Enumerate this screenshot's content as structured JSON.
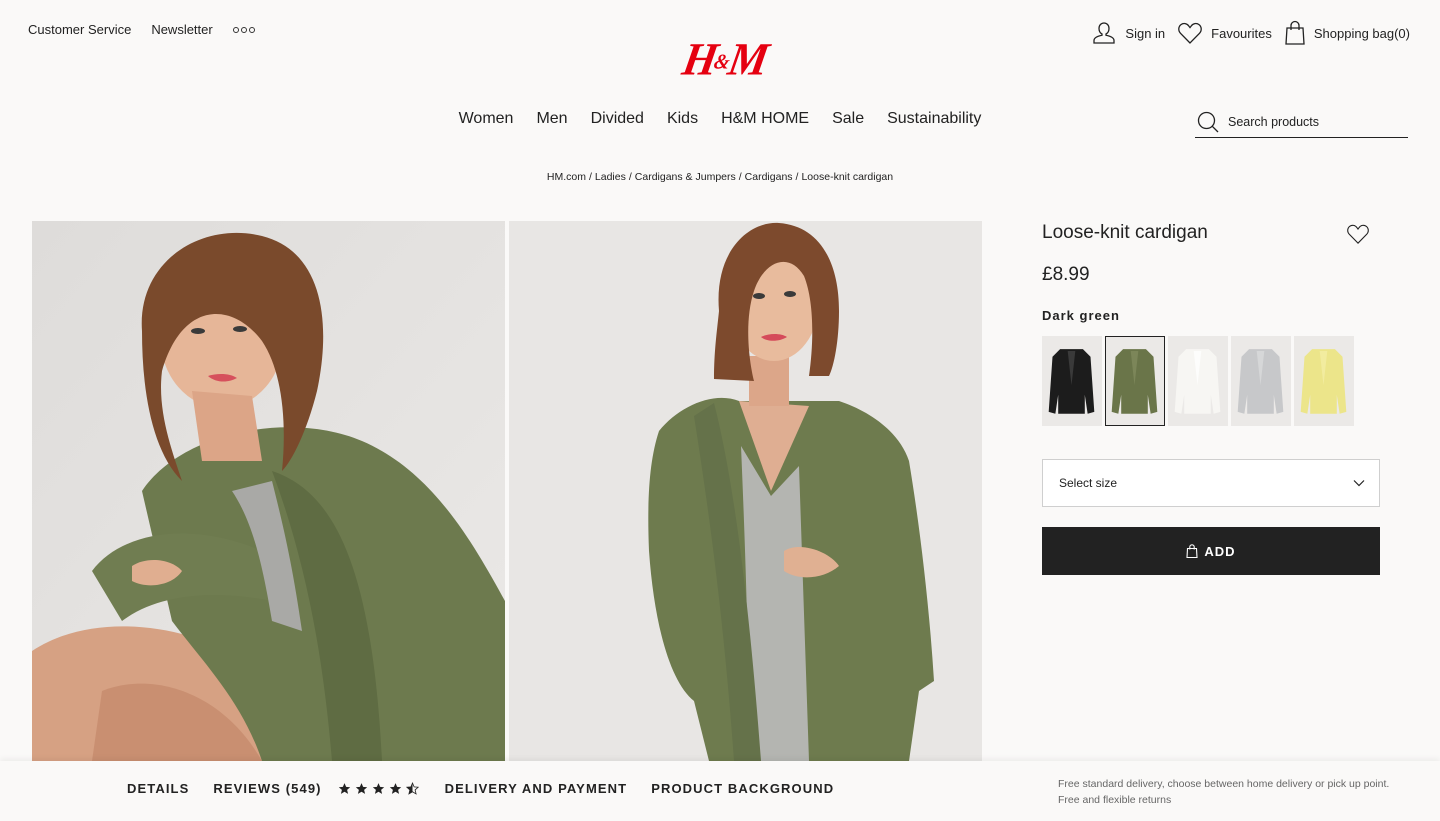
{
  "topbar": {
    "left_links": [
      "Customer Service",
      "Newsletter"
    ],
    "more_icon": "more-dots-icon",
    "sign_in": "Sign in",
    "favourites": "Favourites",
    "shopping_bag": "Shopping bag(0)"
  },
  "brand": {
    "logo_text_h": "H",
    "logo_text_amp": "&",
    "logo_text_m": "M",
    "color": "#e50010"
  },
  "nav": {
    "items": [
      "Women",
      "Men",
      "Divided",
      "Kids",
      "H&M HOME",
      "Sale",
      "Sustainability"
    ]
  },
  "search": {
    "placeholder": "Search products",
    "value": ""
  },
  "breadcrumb": [
    "HM.com",
    "Ladies",
    "Cardigans & Jumpers",
    "Cardigans",
    "Loose-knit cardigan"
  ],
  "product": {
    "title": "Loose-knit cardigan",
    "price": "£8.99",
    "selected_color": "Dark green",
    "swatches": [
      {
        "name": "Black",
        "color": "#1c1c1c",
        "selected": false
      },
      {
        "name": "Dark green",
        "color": "#6a7549",
        "selected": true
      },
      {
        "name": "White",
        "color": "#f7f6f3",
        "selected": false
      },
      {
        "name": "Light grey",
        "color": "#c7c8ca",
        "selected": false
      },
      {
        "name": "Light yellow",
        "color": "#ece58a",
        "selected": false
      }
    ],
    "size_select": {
      "placeholder": "Select size"
    },
    "add_button": "ADD",
    "images": [
      {
        "alt": "Model seated wearing dark green loose-knit cardigan"
      },
      {
        "alt": "Model standing wearing dark green loose-knit cardigan over grey top"
      }
    ]
  },
  "bottom_bar": {
    "tabs": {
      "details": "DETAILS",
      "reviews": "REVIEWS (549)",
      "delivery": "DELIVERY AND PAYMENT",
      "background": "PRODUCT BACKGROUND"
    },
    "rating": 4.5,
    "rating_max": 5,
    "delivery_note": "Free standard delivery, choose between home delivery or pick up point. Free and flexible returns"
  },
  "colors": {
    "background": "#faf9f8",
    "text": "#222222",
    "button": "#222222",
    "accent": "#e50010"
  }
}
